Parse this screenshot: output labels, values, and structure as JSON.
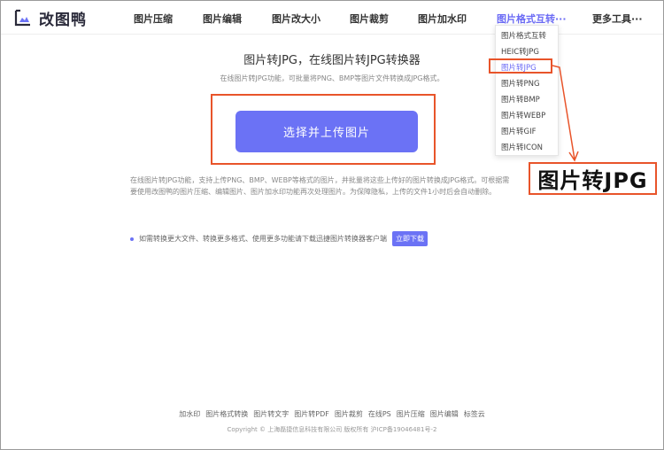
{
  "brand": {
    "name": "改图鸭",
    "accent": "#6b72f5",
    "highlight": "#e8542a"
  },
  "nav": [
    {
      "label": "图片压缩"
    },
    {
      "label": "图片编辑"
    },
    {
      "label": "图片改大小"
    },
    {
      "label": "图片裁剪"
    },
    {
      "label": "图片加水印"
    },
    {
      "label": "图片格式互转···"
    },
    {
      "label": "更多工具···"
    }
  ],
  "dropdown": [
    "图片格式互转",
    "HEIC转JPG",
    "图片转JPG",
    "图片转PNG",
    "图片转BMP",
    "图片转WEBP",
    "图片转GIF",
    "图片转ICON"
  ],
  "main": {
    "title": "图片转JPG，在线图片转JPG转换器",
    "subtitle": "在线图片转JPG功能，可批量将PNG、BMP等图片文件转换成JPG格式。",
    "upload_label": "选择并上传图片",
    "desc_line1": "在线图片转JPG功能，支持上传PNG、BMP、WEBP等格式的图片，并批量将这些上传好的图片转换成JPG格式。可根据需",
    "desc_line2": "要使用改图鸭的图片压缩、编辑图片、图片加水印功能再次处理图片。为保障隐私，上传的文件1小时后会自动删除。",
    "tip": "如需转换更大文件、转换更多格式、使用更多功能请下载迅捷图片转换器客户端",
    "tip_button": "立即下载"
  },
  "callout": "图片转JPG",
  "footer": {
    "links": [
      "加水印",
      "图片格式转换",
      "图片转文字",
      "图片转PDF",
      "图片裁剪",
      "在线PS",
      "图片压缩",
      "图片编辑",
      "标签云"
    ],
    "copyright": "Copyright © 上海磊捷信息科技有限公司 版权所有 沪ICP备19046481号-2"
  }
}
